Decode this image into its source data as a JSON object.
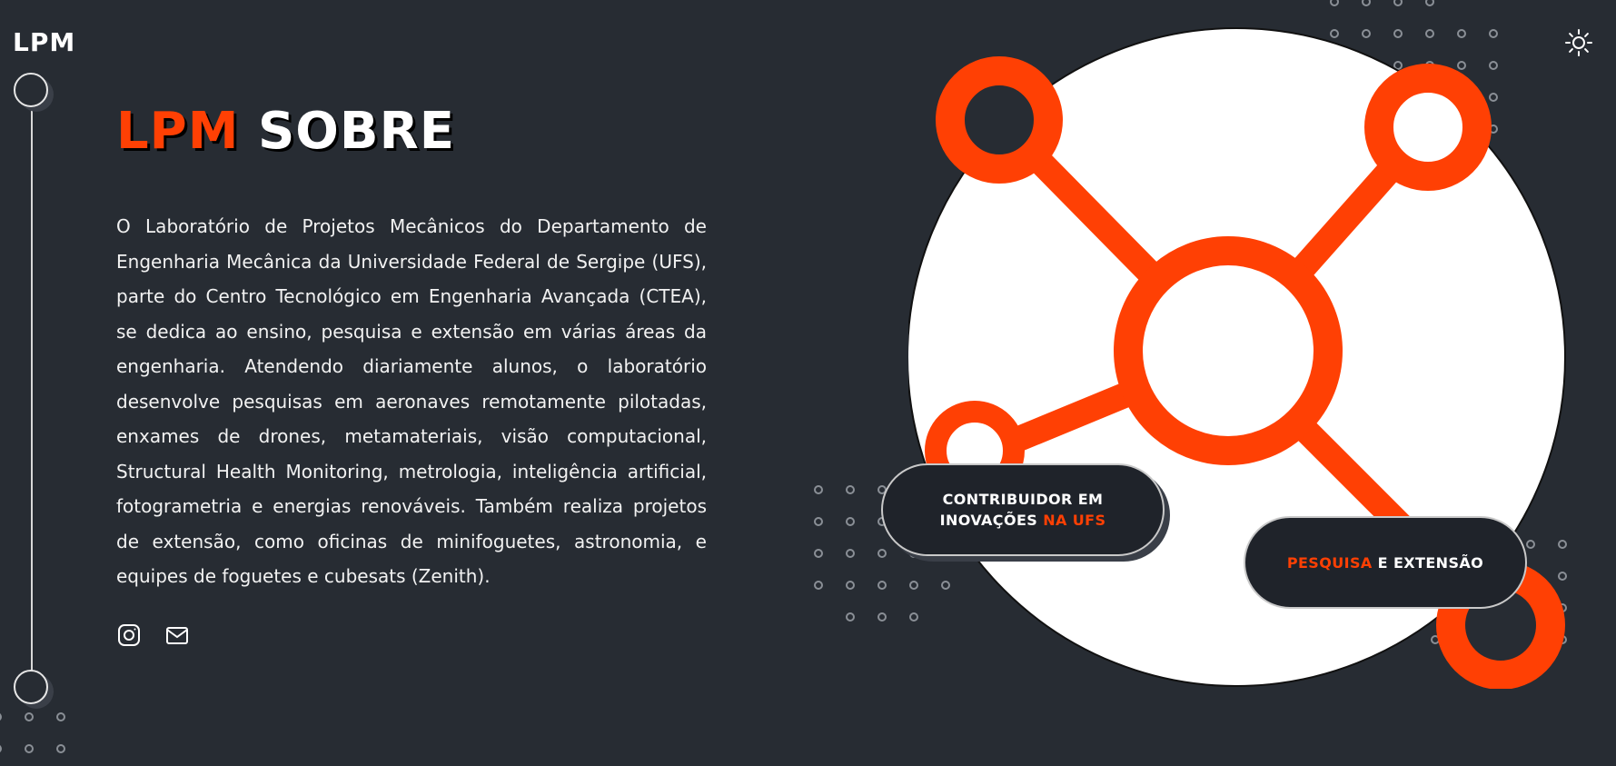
{
  "header": {
    "logo": "LPM"
  },
  "hero": {
    "title_accent": "LPM",
    "title_rest": "SOBRE",
    "description": "O Laboratório de Projetos Mecânicos do Departamento de Engenharia Mecânica da Universidade Federal de Sergipe (UFS), parte do Centro Tecnológico em Engenharia Avançada (CTEA), se dedica ao ensino, pesquisa e extensão em várias áreas da engenharia. Atendendo diariamente alunos, o laboratório desenvolve pesquisas em aeronaves remotamente pilotadas, enxames de drones, metamateriais, visão computacional, Structural Health Monitoring, metrologia, inteligência artificial, fotogrametria e energias renováveis. Também realiza projetos de extensão, como oficinas de minifoguetes, astronomia, e equipes de foguetes e cubesats (Zenith)."
  },
  "social": {
    "instagram_icon": "instagram-icon",
    "email_icon": "mail-icon"
  },
  "theme_toggle_icon": "sun-icon",
  "badges": {
    "badge1_line1": "CONTRIBUIDOR EM",
    "badge1_line2_white": "INOVAÇÕES",
    "badge1_line2_accent": "NA UFS",
    "badge2_accent": "PESQUISA",
    "badge2_white": "E EXTENSÃO"
  },
  "colors": {
    "background": "#272c33",
    "accent": "#ff4004",
    "pill_background": "#1f232a",
    "circle_white": "#ffffff"
  }
}
